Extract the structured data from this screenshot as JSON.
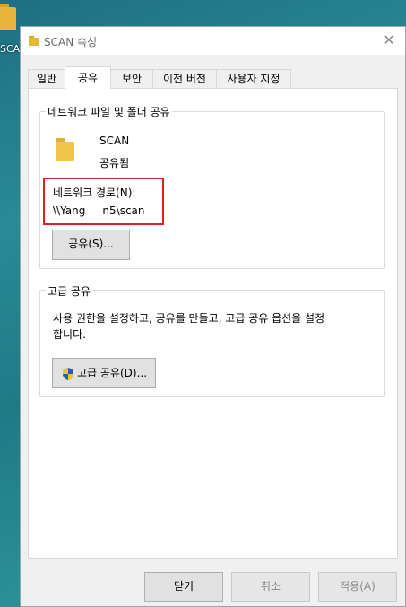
{
  "desktop": {
    "folder_label": "SCA"
  },
  "window": {
    "title": "SCAN 속성",
    "close_glyph": "✕"
  },
  "tabs": [
    {
      "label": "일반"
    },
    {
      "label": "공유"
    },
    {
      "label": "보안"
    },
    {
      "label": "이전 버전"
    },
    {
      "label": "사용자 지정"
    }
  ],
  "network_share": {
    "group_title": "네트워크 파일 및 폴더 공유",
    "folder_name": "SCAN",
    "folder_status": "공유됨",
    "path_label": "네트워크 경로(N):",
    "path_value": "\\\\Yang     n5\\scan",
    "share_button": "공유(S)..."
  },
  "advanced_share": {
    "group_title": "고급 공유",
    "description_line1": "사용 권한을 설정하고, 공유를 만들고, 고급 공유 옵션을 설정",
    "description_line2": "합니다.",
    "button_label": "고급 공유(D)..."
  },
  "footer": {
    "close_button": "닫기",
    "cancel_button": "취소",
    "apply_button": "적용(A)"
  },
  "colors": {
    "highlight_box": "#e02020",
    "folder": "#f0c64b"
  }
}
